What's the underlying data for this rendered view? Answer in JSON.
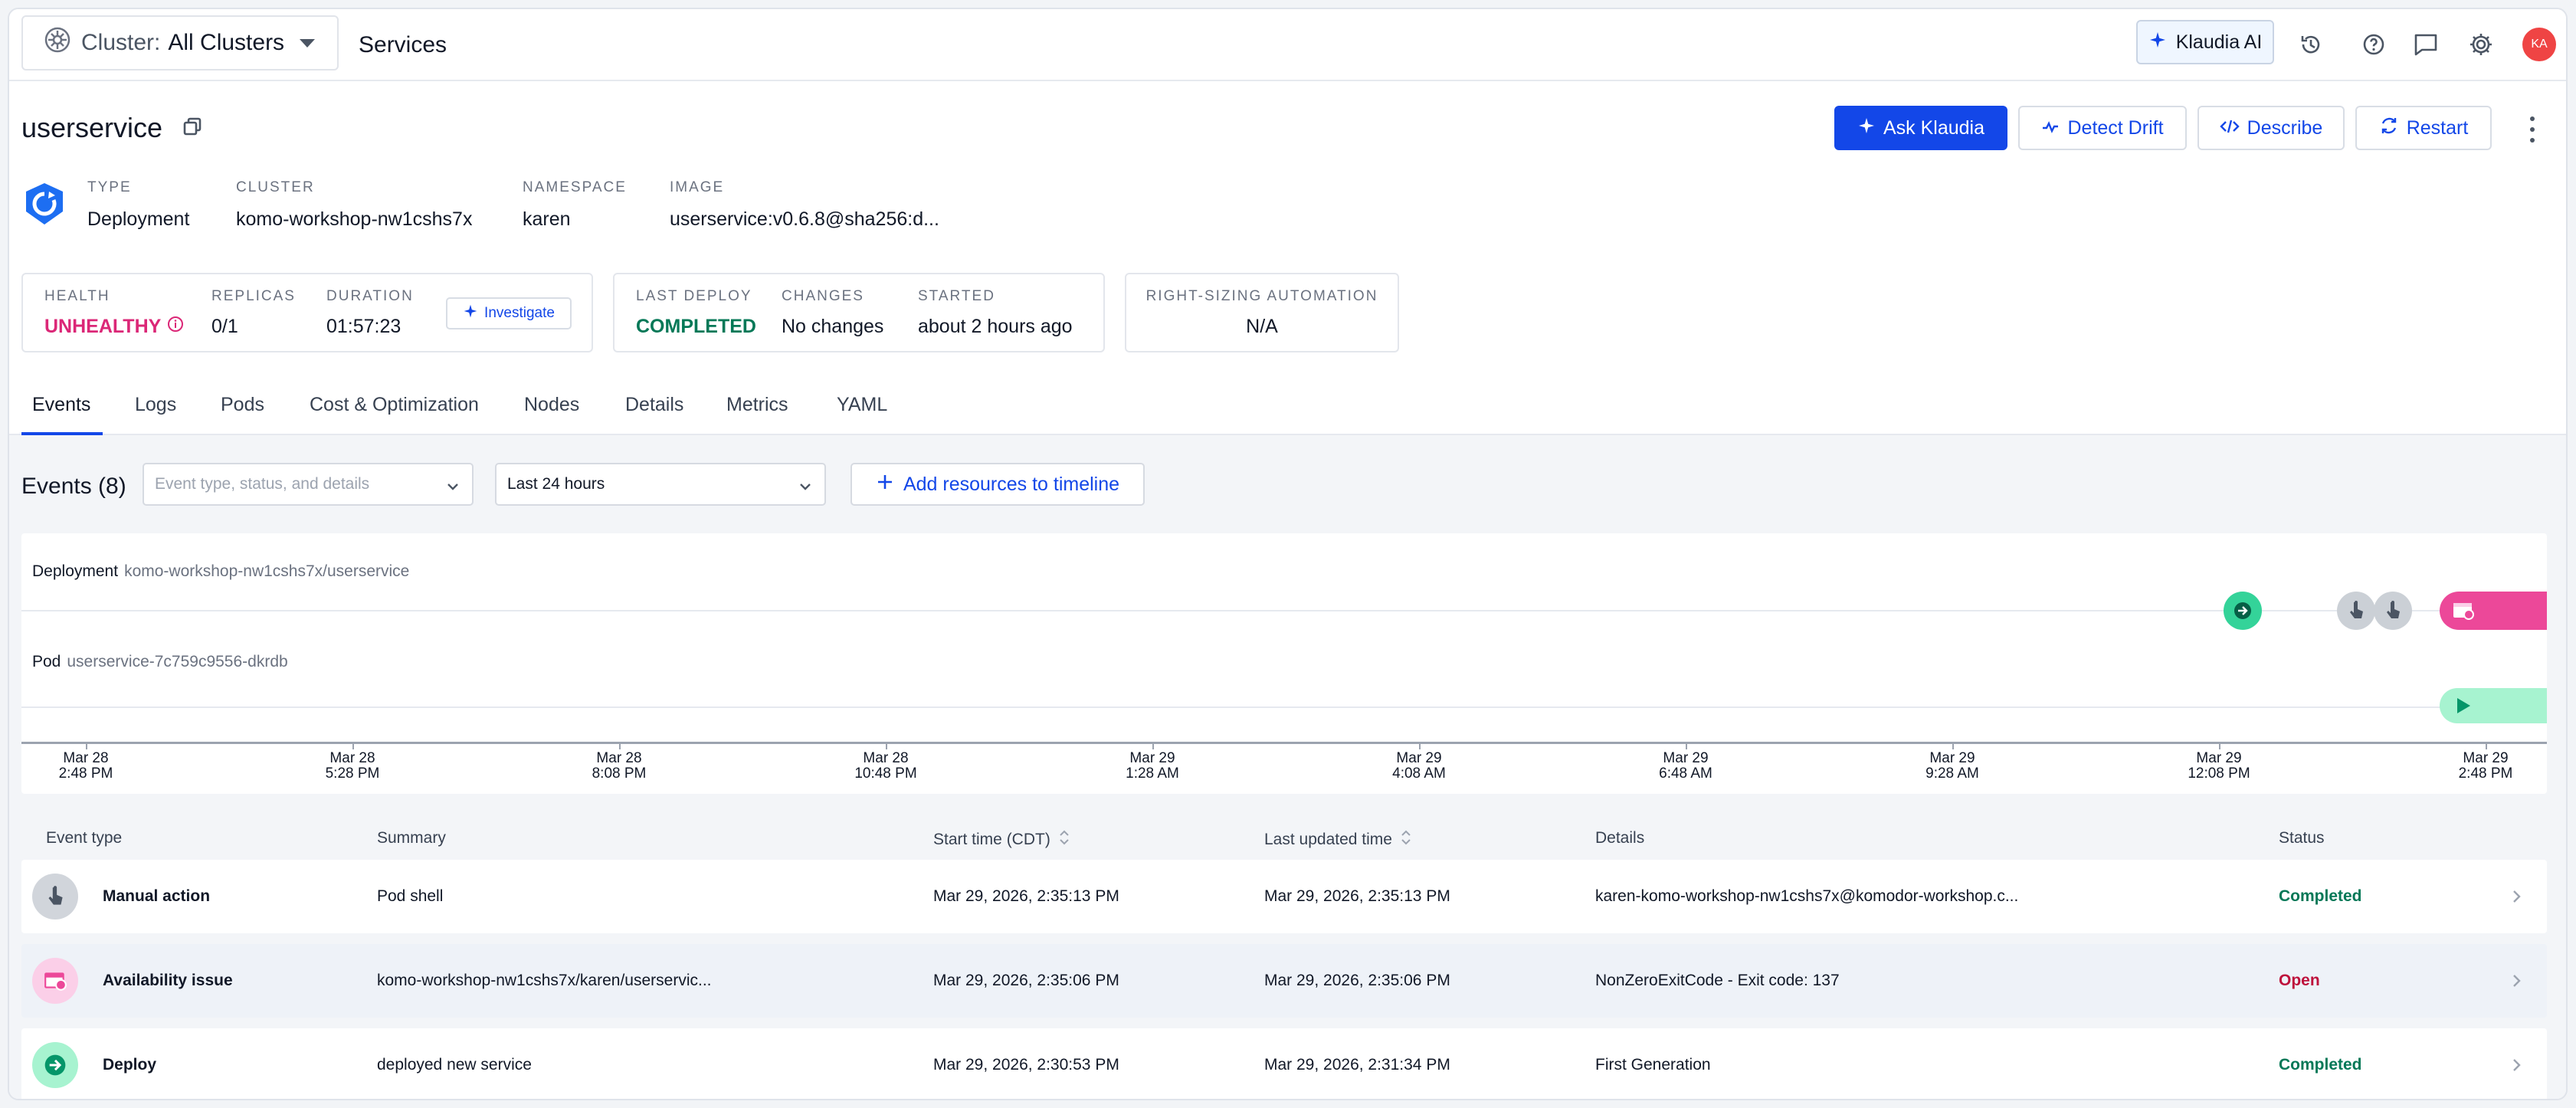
{
  "topbar": {
    "cluster_label": "Cluster:",
    "cluster_value": "All Clusters",
    "page": "Services",
    "klaudia_button": "Klaudia AI",
    "avatar_initials": "KA"
  },
  "service": {
    "name": "userservice",
    "actions": {
      "ask": "Ask Klaudia",
      "drift": "Detect Drift",
      "describe": "Describe",
      "restart": "Restart"
    },
    "meta": [
      {
        "key": "TYPE",
        "value": "Deployment"
      },
      {
        "key": "CLUSTER",
        "value": "komo-workshop-nw1cshs7x"
      },
      {
        "key": "NAMESPACE",
        "value": "karen"
      },
      {
        "key": "IMAGE",
        "value": "userservice:v0.6.8@sha256:d..."
      }
    ]
  },
  "status": {
    "health_label": "HEALTH",
    "health_value": "UNHEALTHY",
    "replicas_label": "REPLICAS",
    "replicas_value": "0/1",
    "duration_label": "DURATION",
    "duration_value": "01:57:23",
    "investigate": "Investigate",
    "last_deploy_label": "LAST DEPLOY",
    "last_deploy_value": "COMPLETED",
    "changes_label": "CHANGES",
    "changes_value": "No changes",
    "started_label": "STARTED",
    "started_value": "about 2 hours ago",
    "rightsizing_label": "RIGHT-SIZING AUTOMATION",
    "rightsizing_value": "N/A"
  },
  "tabs": [
    "Events",
    "Logs",
    "Pods",
    "Cost & Optimization",
    "Nodes",
    "Details",
    "Metrics",
    "YAML"
  ],
  "events": {
    "title": "Events (8)",
    "filter_placeholder": "Event type, status, and details",
    "range": "Last 24 hours",
    "add_resources": "Add resources to timeline"
  },
  "timeline": {
    "rows": [
      {
        "kind": "Deployment",
        "name": "komo-workshop-nw1cshs7x/userservice"
      },
      {
        "kind": "Pod",
        "name": "userservice-7c759c9556-dkrdb"
      }
    ],
    "ticks": [
      {
        "date": "Mar 28",
        "time": "2:48 PM"
      },
      {
        "date": "Mar 28",
        "time": "5:28 PM"
      },
      {
        "date": "Mar 28",
        "time": "8:08 PM"
      },
      {
        "date": "Mar 28",
        "time": "10:48 PM"
      },
      {
        "date": "Mar 29",
        "time": "1:28 AM"
      },
      {
        "date": "Mar 29",
        "time": "4:08 AM"
      },
      {
        "date": "Mar 29",
        "time": "6:48 AM"
      },
      {
        "date": "Mar 29",
        "time": "9:28 AM"
      },
      {
        "date": "Mar 29",
        "time": "12:08 PM"
      },
      {
        "date": "Mar 29",
        "time": "2:48 PM"
      }
    ]
  },
  "table": {
    "headers": [
      "Event type",
      "Summary",
      "Start time (CDT)",
      "Last updated time",
      "Details",
      "Status"
    ],
    "rows": [
      {
        "type": "Manual action",
        "summary": "Pod shell",
        "start": "Mar 29, 2026, 2:35:13 PM",
        "updated": "Mar 29, 2026, 2:35:13 PM",
        "details": "karen-komo-workshop-nw1cshs7x@komodor-workshop.c...",
        "status": "Completed"
      },
      {
        "type": "Availability issue",
        "summary": "komo-workshop-nw1cshs7x/karen/userservic...",
        "start": "Mar 29, 2026, 2:35:06 PM",
        "updated": "Mar 29, 2026, 2:35:06 PM",
        "details": "NonZeroExitCode - Exit code: 137",
        "status": "Open"
      },
      {
        "type": "Deploy",
        "summary": "deployed new service",
        "start": "Mar 29, 2026, 2:30:53 PM",
        "updated": "Mar 29, 2026, 2:31:34 PM",
        "details": "First Generation",
        "status": "Completed"
      }
    ]
  }
}
